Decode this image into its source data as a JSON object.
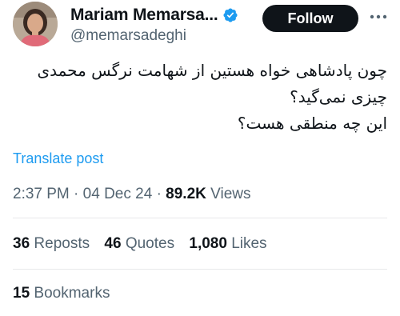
{
  "author": {
    "name": "Mariam Memarsa...",
    "handle": "@memarsadeghi",
    "verified_color": "#1d9bf0"
  },
  "actions": {
    "follow_label": "Follow"
  },
  "post": {
    "lines": [
      "چون پادشاهی خواه هستین از شهامت نرگس محمدی",
      "چیزی نمی‌گید؟",
      "این چه منطقی هست؟"
    ],
    "translate_label": "Translate post"
  },
  "meta": {
    "time": "2:37 PM",
    "separator": "·",
    "date": "04 Dec 24",
    "views_count": "89.2K",
    "views_label": "Views"
  },
  "stats": {
    "reposts_count": "36",
    "reposts_label": "Reposts",
    "quotes_count": "46",
    "quotes_label": "Quotes",
    "likes_count": "1,080",
    "likes_label": "Likes",
    "bookmarks_count": "15",
    "bookmarks_label": "Bookmarks"
  },
  "colors": {
    "accent": "#1d9bf0",
    "text_primary": "#0f1419",
    "text_secondary": "#536471"
  }
}
